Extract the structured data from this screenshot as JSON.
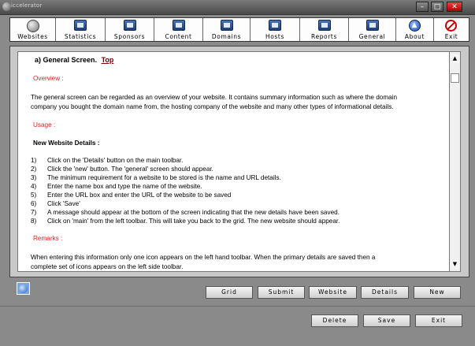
{
  "window": {
    "title": "iccelerator"
  },
  "toolbar": {
    "items": [
      {
        "label": "Websites",
        "icon": "websites-globe-icon"
      },
      {
        "label": "Statistics",
        "icon": "statistics-folder-icon"
      },
      {
        "label": "Sponsors",
        "icon": "sponsors-folder-icon"
      },
      {
        "label": "Content",
        "icon": "content-folder-icon"
      },
      {
        "label": "Domains",
        "icon": "domains-folder-icon"
      },
      {
        "label": "Hosts",
        "icon": "hosts-folder-icon"
      },
      {
        "label": "Reports",
        "icon": "reports-folder-icon"
      },
      {
        "label": "General",
        "icon": "general-folder-icon"
      },
      {
        "label": "About",
        "icon": "about-info-icon"
      },
      {
        "label": "Exit",
        "icon": "exit-icon"
      }
    ]
  },
  "document": {
    "heading": "a)  General Screen.",
    "top_link": "Top",
    "overview_label": "Overview :",
    "overview_text_1": "The general screen can be regarded as an overview of your website. It contains summary information such as where the domain",
    "overview_text_2": "company you bought the domain name from, the    hosting company of the website and many other types of informational details.",
    "usage_label": "Usage :",
    "new_details_label": "New Website Details :",
    "steps": [
      {
        "n": "1)",
        "text": "Click on the 'Details' button on the main toolbar."
      },
      {
        "n": "2)",
        "text": "Click the 'new' button. The 'general' screen should appear."
      },
      {
        "n": "3)",
        "text": "The minimum requirement for a website to be stored is the name and URL details."
      },
      {
        "n": "4)",
        "text": "Enter the name box and type the name of the website."
      },
      {
        "n": "5)",
        "text": "Enter the URL box and enter the URL of the website to be saved"
      },
      {
        "n": "6)",
        "text": "Click 'Save'"
      },
      {
        "n": "7)",
        "text": "A message should appear at the bottom of the screen indicating that the new details have been saved."
      },
      {
        "n": "8)",
        "text": "Click on 'main' from the left toolbar. This will take you back to the grid. The new website should appear."
      }
    ],
    "remarks_label": "Remarks :",
    "remarks_text_1": "When entering this information only one icon appears on the left hand toolbar. When the primary details are saved then a",
    "remarks_text_2": "complete set of icons appears on the left side toolbar."
  },
  "nav_buttons": {
    "grid": "Grid",
    "submit": "Submit",
    "website": "Website",
    "details": "Details",
    "new": "New"
  },
  "action_buttons": {
    "delete": "Delete",
    "save": "Save",
    "exit": "Exit"
  },
  "colors": {
    "accent_red": "#dd2222",
    "link_dark_red": "#7a0000"
  }
}
